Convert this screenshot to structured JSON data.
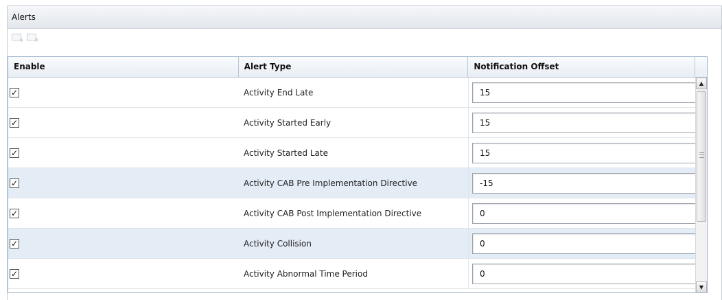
{
  "panel": {
    "title": "Alerts"
  },
  "toolbar": {
    "add_icon": "add-row-icon",
    "remove_icon": "remove-row-icon"
  },
  "table": {
    "columns": [
      "Enable",
      "Alert Type",
      "Notification Offset"
    ],
    "rows": [
      {
        "enabled": "✓",
        "alert_type": "Activity End Late",
        "offset": "15"
      },
      {
        "enabled": "✓",
        "alert_type": "Activity Started Early",
        "offset": "15"
      },
      {
        "enabled": "✓",
        "alert_type": "Activity Started Late",
        "offset": "15"
      },
      {
        "enabled": "✓",
        "alert_type": "Activity CAB Pre Implementation Directive",
        "offset": "-15"
      },
      {
        "enabled": "✓",
        "alert_type": "Activity CAB Post Implementation Directive",
        "offset": "0"
      },
      {
        "enabled": "✓",
        "alert_type": "Activity Collision",
        "offset": "0"
      },
      {
        "enabled": "✓",
        "alert_type": "Activity Abnormal Time Period",
        "offset": "0"
      }
    ]
  },
  "colors": {
    "row_alt": "#e4ecf6",
    "header_bg": "#e9eef4",
    "grid_border": "#9eb6ce"
  }
}
